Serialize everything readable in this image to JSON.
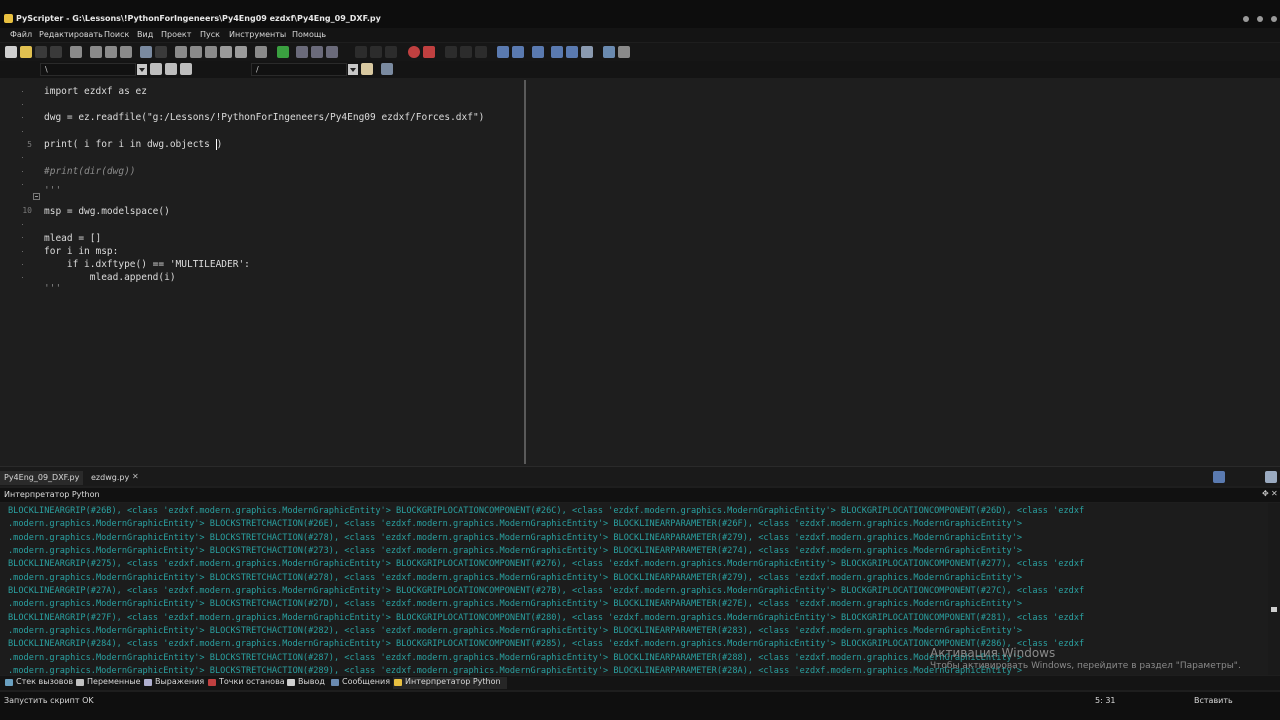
{
  "window": {
    "title": "PyScripter - G:\\Lessons\\!PythonForIngeneers\\Py4Eng09 ezdxf\\Py4Eng_09_DXF.py"
  },
  "menu": [
    "Файл",
    "Редактировать",
    "Поиск",
    "Вид",
    "Проект",
    "Пуск",
    "Инструменты",
    "Помощь"
  ],
  "toolbar2": {
    "search_value": "\\",
    "replace_value": "/"
  },
  "editor": {
    "line_numbers": [
      "5",
      "10"
    ],
    "lines": [
      "import ezdxf as ez",
      "dwg = ez.readfile(\"g:/Lessons/!PythonForIngeneers/Py4Eng09 ezdxf/Forces.dxf\")",
      "print( i for i in dwg.objects ",
      ")",
      "#print(dir(dwg))",
      "'''",
      "msp = dwg.modelspace()",
      "mlead = []",
      "for i in msp:",
      "    if i.dxftype() == 'MULTILEADER':",
      "        mlead.append(i)",
      "'''"
    ]
  },
  "tabs": [
    {
      "label": "Py4Eng_09_DXF.py",
      "active": true
    },
    {
      "label": "ezdwg.py",
      "active": false
    }
  ],
  "console": {
    "title": "Интерпретатор Python",
    "lines": [
      "BLOCKLINEARGRIP(#26B), <class 'ezdxf.modern.graphics.ModernGraphicEntity'> BLOCKGRIPLOCATIONCOMPONENT(#26C), <class 'ezdxf.modern.graphics.ModernGraphicEntity'> BLOCKGRIPLOCATIONCOMPONENT(#26D), <class 'ezdxf",
      ".modern.graphics.ModernGraphicEntity'> BLOCKSTRETCHACTION(#26E), <class 'ezdxf.modern.graphics.ModernGraphicEntity'> BLOCKLINEARPARAMETER(#26F), <class 'ezdxf.modern.graphics.ModernGraphicEntity'>",
      ".modern.graphics.ModernGraphicEntity'> BLOCKSTRETCHACTION(#278), <class 'ezdxf.modern.graphics.ModernGraphicEntity'> BLOCKLINEARPARAMETER(#279), <class 'ezdxf.modern.graphics.ModernGraphicEntity'>",
      ".modern.graphics.ModernGraphicEntity'> BLOCKSTRETCHACTION(#273), <class 'ezdxf.modern.graphics.ModernGraphicEntity'> BLOCKLINEARPARAMETER(#274), <class 'ezdxf.modern.graphics.ModernGraphicEntity'>",
      "BLOCKLINEARGRIP(#275), <class 'ezdxf.modern.graphics.ModernGraphicEntity'> BLOCKGRIPLOCATIONCOMPONENT(#276), <class 'ezdxf.modern.graphics.ModernGraphicEntity'> BLOCKGRIPLOCATIONCOMPONENT(#277), <class 'ezdxf",
      ".modern.graphics.ModernGraphicEntity'> BLOCKSTRETCHACTION(#278), <class 'ezdxf.modern.graphics.ModernGraphicEntity'> BLOCKLINEARPARAMETER(#279), <class 'ezdxf.modern.graphics.ModernGraphicEntity'>",
      "BLOCKLINEARGRIP(#27A), <class 'ezdxf.modern.graphics.ModernGraphicEntity'> BLOCKGRIPLOCATIONCOMPONENT(#27B), <class 'ezdxf.modern.graphics.ModernGraphicEntity'> BLOCKGRIPLOCATIONCOMPONENT(#27C), <class 'ezdxf",
      ".modern.graphics.ModernGraphicEntity'> BLOCKSTRETCHACTION(#27D), <class 'ezdxf.modern.graphics.ModernGraphicEntity'> BLOCKLINEARPARAMETER(#27E), <class 'ezdxf.modern.graphics.ModernGraphicEntity'>",
      "BLOCKLINEARGRIP(#27F), <class 'ezdxf.modern.graphics.ModernGraphicEntity'> BLOCKGRIPLOCATIONCOMPONENT(#280), <class 'ezdxf.modern.graphics.ModernGraphicEntity'> BLOCKGRIPLOCATIONCOMPONENT(#281), <class 'ezdxf",
      ".modern.graphics.ModernGraphicEntity'> BLOCKSTRETCHACTION(#282), <class 'ezdxf.modern.graphics.ModernGraphicEntity'> BLOCKLINEARPARAMETER(#283), <class 'ezdxf.modern.graphics.ModernGraphicEntity'>",
      "BLOCKLINEARGRIP(#284), <class 'ezdxf.modern.graphics.ModernGraphicEntity'> BLOCKGRIPLOCATIONCOMPONENT(#285), <class 'ezdxf.modern.graphics.ModernGraphicEntity'> BLOCKGRIPLOCATIONCOMPONENT(#286), <class 'ezdxf",
      ".modern.graphics.ModernGraphicEntity'> BLOCKSTRETCHACTION(#287), <class 'ezdxf.modern.graphics.ModernGraphicEntity'> BLOCKLINEARPARAMETER(#288), <class 'ezdxf.modern.graphics.ModernGraphicEntity'>",
      ".modern.graphics.ModernGraphicEntity'> BLOCKSTRETCHACTION(#289), <class 'ezdxf.modern.graphics.ModernGraphicEntity'> BLOCKLINEARPARAMETER(#28A), <class 'ezdxf.modern.graphics.ModernGraphicEntity'>"
    ],
    "watermark_title": "Активация Windows",
    "watermark_text": "Чтобы активировать Windows, перейдите в раздел \"Параметры\"."
  },
  "bottom_tabs": [
    "Стек вызовов",
    "Переменные",
    "Выражения",
    "Точки останова",
    "Вывод",
    "Сообщения",
    "Интерпретатор Python"
  ],
  "status": {
    "message": "Запустить скрипт OK",
    "position": "5: 31",
    "mode": "Вставить"
  },
  "colors": {
    "console_text": "#2aa0a0",
    "background": "#1e1e1e"
  }
}
